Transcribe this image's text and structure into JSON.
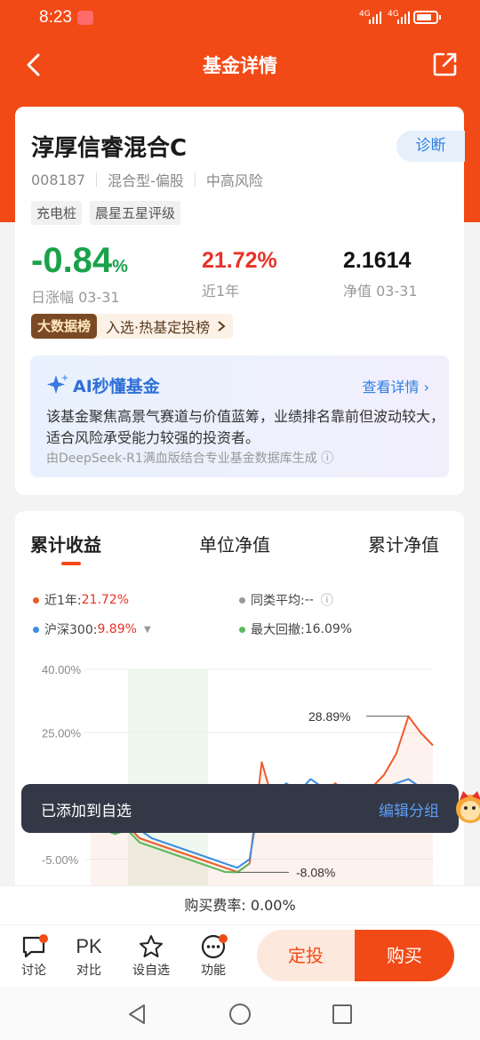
{
  "status_bar": {
    "time": "8:23",
    "signal1": "4G",
    "signal2": "4G"
  },
  "nav": {
    "title": "基金详情"
  },
  "fund": {
    "name": "淳厚信睿混合C",
    "diagnose_label": "诊断",
    "code": "008187",
    "category": "混合型-偏股",
    "risk": "中高风险",
    "tags": [
      "充电桩",
      "晨星五星评级"
    ],
    "daily_change": "-0.84",
    "daily_change_unit": "%",
    "daily_change_label": "日涨幅 03-31",
    "year_return": "21.72%",
    "year_return_label": "近1年",
    "nav_value": "2.1614",
    "nav_label": "净值 03-31",
    "rank_badge": "大数据榜",
    "rank_text": "入选·热基定投榜"
  },
  "ai": {
    "title": "AI秒懂基金",
    "more": "查看详情",
    "description": "该基金聚焦高景气赛道与价值蓝筹，业绩排名靠前但波动较大，适合风险承受能力较强的投资者。",
    "source": "由DeepSeek-R1满血版结合专业基金数据库生成"
  },
  "tabs": [
    "累计收益",
    "单位净值",
    "累计净值"
  ],
  "legend": {
    "fund_label": "近1年:",
    "fund_value": "21.72%",
    "peer_label": "同类平均:",
    "peer_value": "--",
    "index_label": "沪深300:",
    "index_value": "9.89%",
    "drawdown_label": "最大回撤:",
    "drawdown_value": "16.09%"
  },
  "chart_data": {
    "type": "line",
    "y_ticks": [
      "40.00%",
      "25.00%",
      "10.00%",
      "-5.00%"
    ],
    "ylim": [
      -12,
      40
    ],
    "annotations": [
      "28.89%",
      "-8.08%"
    ],
    "series": [
      {
        "name": "近1年",
        "color": "#f05a28",
        "values": [
          4,
          3,
          2,
          3,
          0,
          -1,
          -2,
          -3,
          -4,
          -5,
          -6,
          -7,
          -8,
          -6,
          18,
          8,
          11,
          9,
          12,
          10,
          13,
          11,
          10,
          12,
          15,
          20,
          28.89,
          25,
          22
        ]
      },
      {
        "name": "沪深300",
        "color": "#3e8ede",
        "values": [
          5,
          4,
          3,
          4,
          2,
          0,
          -1,
          -2,
          -3,
          -4,
          -5,
          -6,
          -7,
          -5,
          12,
          10,
          13,
          11,
          14,
          12,
          11,
          12,
          10,
          11,
          12,
          13,
          14,
          12,
          11
        ]
      },
      {
        "name": "最大回撤",
        "color": "#5cb85c",
        "values": [
          3,
          2,
          1,
          2,
          -1,
          -2,
          -3,
          -4,
          -5,
          -6,
          -7,
          -8,
          -8.08,
          -6
        ]
      }
    ]
  },
  "toast": {
    "message": "已添加到自选",
    "action": "编辑分组"
  },
  "fee": {
    "text": "购买费率:  0.00%"
  },
  "bottom": {
    "discuss": "讨论",
    "pk_icon": "PK",
    "compare": "对比",
    "watch": "设自选",
    "function": "功能",
    "sip": "定投",
    "buy": "购买"
  }
}
